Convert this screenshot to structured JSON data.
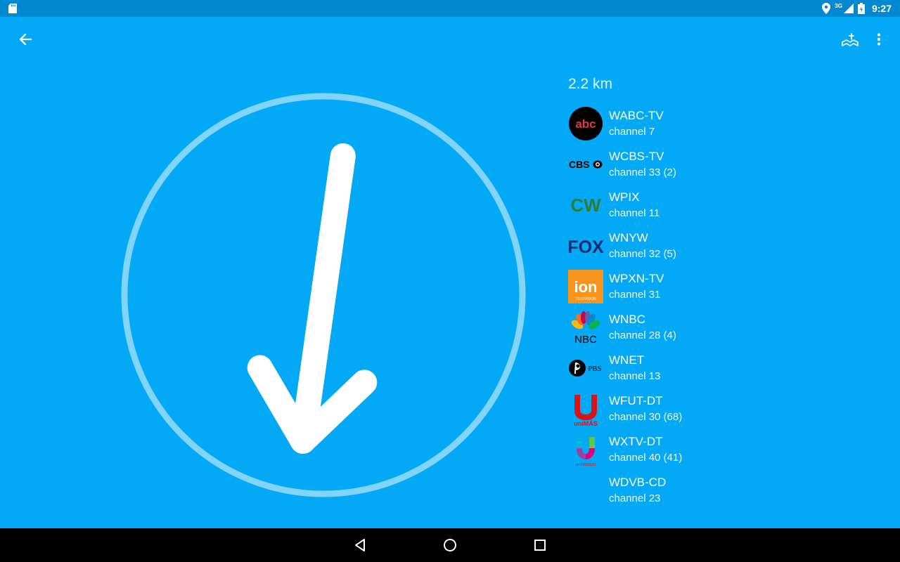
{
  "status_bar": {
    "time": "9:27",
    "network_label": "3G",
    "icons": [
      "sd-card-icon",
      "location-icon",
      "signal-icon",
      "battery-icon"
    ]
  },
  "toolbar": {
    "back_icon": "arrow-back-icon",
    "map_icon": "map-icon",
    "more_icon": "more-vert-icon"
  },
  "compass": {
    "arrow_heading_deg": 188,
    "ring_color": "#81D4FA",
    "arrow_color": "#FFFFFF"
  },
  "distance": "2.2 km",
  "stations": [
    {
      "name": "WABC-TV",
      "channel": "channel 7",
      "logo": "abc-logo"
    },
    {
      "name": "WCBS-TV",
      "channel": "channel 33 (2)",
      "logo": "cbs-logo"
    },
    {
      "name": "WPIX",
      "channel": "channel 11",
      "logo": "cw-logo"
    },
    {
      "name": "WNYW",
      "channel": "channel 32 (5)",
      "logo": "fox-logo"
    },
    {
      "name": "WPXN-TV",
      "channel": "channel 31",
      "logo": "ion-logo"
    },
    {
      "name": "WNBC",
      "channel": "channel 28 (4)",
      "logo": "nbc-logo"
    },
    {
      "name": "WNET",
      "channel": "channel 13",
      "logo": "pbs-logo"
    },
    {
      "name": "WFUT-DT",
      "channel": "channel 30 (68)",
      "logo": "unimas-logo"
    },
    {
      "name": "WXTV-DT",
      "channel": "channel 40 (41)",
      "logo": "univision-logo"
    },
    {
      "name": "WDVB-CD",
      "channel": "channel 23",
      "logo": ""
    }
  ],
  "logo_text": {
    "abc": "abc",
    "cbs": "CBS",
    "cw": "CW",
    "fox": "FOX",
    "ion": "ion",
    "ion_sub": "TELEVISION",
    "nbc": "NBC",
    "pbs": "PBS",
    "unimas": "uniMÁS",
    "univision": "univision"
  },
  "nav": {
    "back_icon": "nav-back-icon",
    "home_icon": "nav-home-icon",
    "recents_icon": "nav-recents-icon"
  },
  "colors": {
    "background": "#03A9F4",
    "status_bar": "#0288D1",
    "nav_bar": "#000000"
  }
}
